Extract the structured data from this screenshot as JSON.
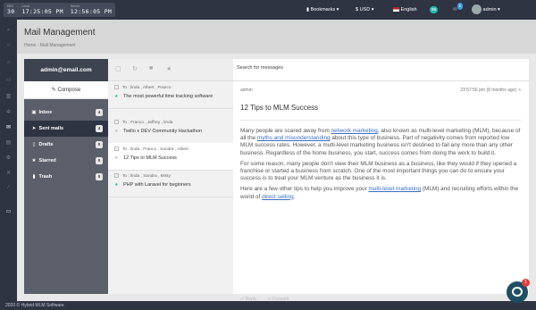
{
  "topbar": {
    "clock": [
      {
        "label": "DEC",
        "value": "30"
      },
      {
        "label": "Local",
        "value": "17:25:05 PM"
      },
      {
        "label": "Server",
        "value": "12:56:05 PM"
      }
    ],
    "bookmarks": "Bookmarks",
    "currency": "$ USD",
    "language": "English",
    "notif_count": "99",
    "msg_count": "5",
    "user": "admin"
  },
  "header": {
    "title": "Mail Management",
    "crumb_home": "Home",
    "crumb_sep": "-",
    "crumb_current": "Mail Management"
  },
  "sidebar": {
    "account": "admin@email.com",
    "compose": "Compose",
    "folders": [
      {
        "label": "Inbox",
        "count": "4"
      },
      {
        "label": "Sent mails",
        "count": "4"
      },
      {
        "label": "Drafts",
        "count": "0"
      },
      {
        "label": "Starred",
        "count": "0"
      },
      {
        "label": "Trash",
        "count": "0"
      }
    ]
  },
  "list": {
    "messages": [
      {
        "to": "To : linda , Albert , Franco",
        "subject": "The most powerful time tracking software",
        "starred": true
      },
      {
        "to": "To : Franco , Jeffrey , linda",
        "subject": "Twilio x DEV Community Hackathon",
        "starred": false
      },
      {
        "to": "To : linda , Franco , Sandra , Albert",
        "subject": "12 Tips to MLM Success",
        "starred": false
      },
      {
        "to": "To : linda , Sandra , Misty",
        "subject": "PHP with Laravel for beginners",
        "starred": true
      }
    ]
  },
  "search": {
    "placeholder": "Search for messages"
  },
  "viewer": {
    "from": "admin",
    "time": "23:57:56 pm",
    "ago": "(8 months ago)",
    "title": "12 Tips to MLM Success",
    "p1_a": "Many people are scared away from ",
    "p1_link1": "network marketing",
    "p1_b": ", also known as multi-level marketing (MLM), because of all the ",
    "p1_link2": "myths and misunderstanding",
    "p1_c": " about this type of business. Part of negativity comes from reported low MLM success rates. However, a multi-level marketing business isn't destined to fail any more than any other business. Regardless of the home business, you start, success comes from doing the work to build it.",
    "p2": "For some reason, many people don't view their MLM business as a business, like they would if they opened a franchise or started a business from scratch. One of the most important things you can do to ensure your success is to treat your MLM venture as the business it is.",
    "p3_a": "Here are a few other tips to help you improve your ",
    "p3_link1": "multi-level marketing",
    "p3_b": " (MLM) and recruiting efforts within the world of ",
    "p3_link2": "direct selling",
    "p3_c": ".",
    "reply": "Reply",
    "forward": "Forward"
  },
  "footer": {
    "text": "2020 © Hybrid MLM Software"
  },
  "chat": {
    "count": "1"
  }
}
